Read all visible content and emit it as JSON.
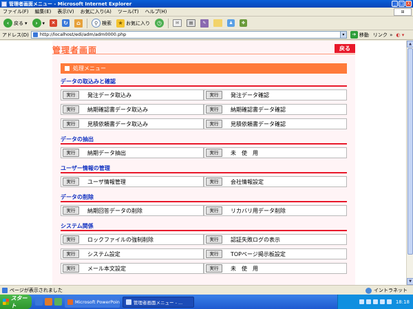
{
  "window": {
    "title": "管理者画面メニュー - Microsoft Internet Explorer",
    "buttons": {
      "minimize": "_",
      "maximize": "□",
      "close": "X"
    }
  },
  "menubar": {
    "items": [
      "ファイル(F)",
      "編集(E)",
      "表示(V)",
      "お気に入り(A)",
      "ツール(T)",
      "ヘルプ(H)"
    ]
  },
  "toolbar": {
    "back_label": "戻る",
    "search_label": "検索",
    "favorites_label": "お気に入り"
  },
  "address": {
    "label": "アドレス(D)",
    "url": "http://localhost/edi/adm/adm0000.php",
    "go_label": "移動",
    "links_label": "リンク"
  },
  "page": {
    "title": "管理者画面",
    "back_button": "戻る",
    "menu_header": "処理メニュー",
    "exec_label": "実行",
    "sections": [
      {
        "title": "データの取込みと確認",
        "rows": [
          [
            "発注データ取込み",
            "発注データ確認"
          ],
          [
            "納期確認書データ取込み",
            "納期確認書データ確認"
          ],
          [
            "見積依頼書データ取込み",
            "見積依頼書データ確認"
          ]
        ]
      },
      {
        "title": "データの抽出",
        "rows": [
          [
            "納期データ抽出",
            "未　使　用"
          ]
        ]
      },
      {
        "title": "ユーザー情報の管理",
        "rows": [
          [
            "ユーザ情報管理",
            "会社情報設定"
          ]
        ]
      },
      {
        "title": "データの削除",
        "rows": [
          [
            "納期回答データの削除",
            "リカバリ用データ削除"
          ]
        ]
      },
      {
        "title": "システム関係",
        "rows": [
          [
            "ロックファイルの強制削除",
            "認証失敗ログの表示"
          ],
          [
            "システム設定",
            "TOPページ掲示板設定"
          ],
          [
            "メール本文設定",
            "未　使　用"
          ]
        ]
      }
    ]
  },
  "statusbar": {
    "text": "ページが表示されました",
    "zone": "イントラネット"
  },
  "taskbar": {
    "start_label": "スタート",
    "tasks": [
      "Microsoft PowerPoint - ...",
      "管理者画面メニュー - ..."
    ],
    "clock": "18:18"
  },
  "colors": {
    "accent": "#ff7a3a",
    "title": "#ff6a3a",
    "section_title": "#1030c0",
    "section_rule": "#e8182a",
    "back_button": "#e8182a",
    "page_bg": "#fff4f6"
  }
}
